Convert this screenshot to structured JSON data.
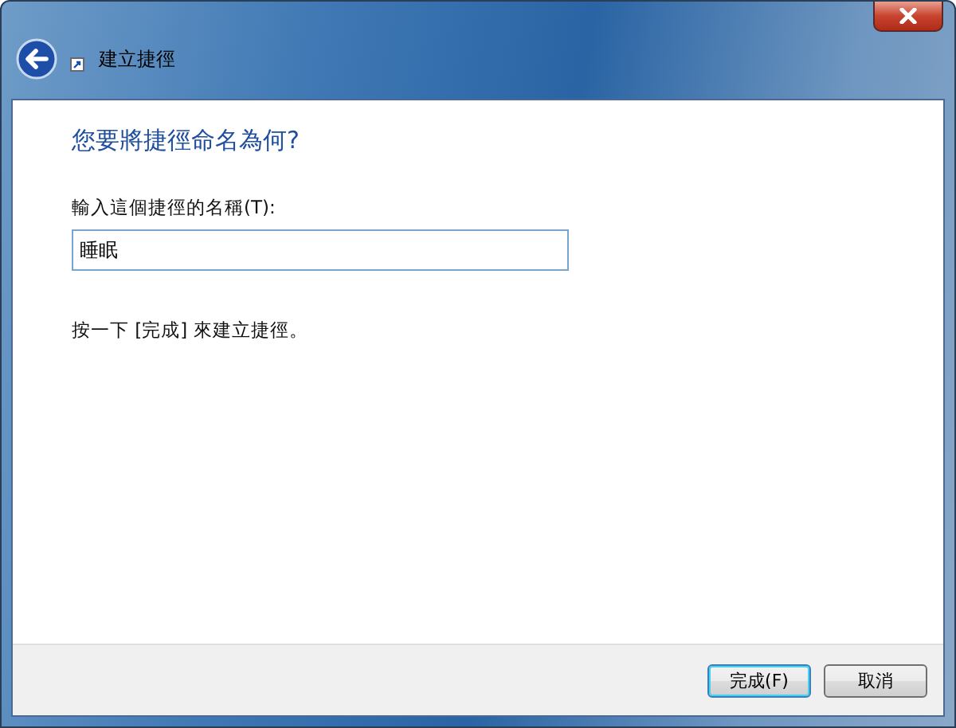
{
  "window": {
    "title": "建立捷徑"
  },
  "heading": "您要將捷徑命名為何?",
  "name_field": {
    "label": "輸入這個捷徑的名稱(T):",
    "value": "睡眠"
  },
  "instruction": "按一下 [完成] 來建立捷徑。",
  "buttons": [
    {
      "label": "完成(F)",
      "default": true
    },
    {
      "label": "取消",
      "default": false
    }
  ]
}
